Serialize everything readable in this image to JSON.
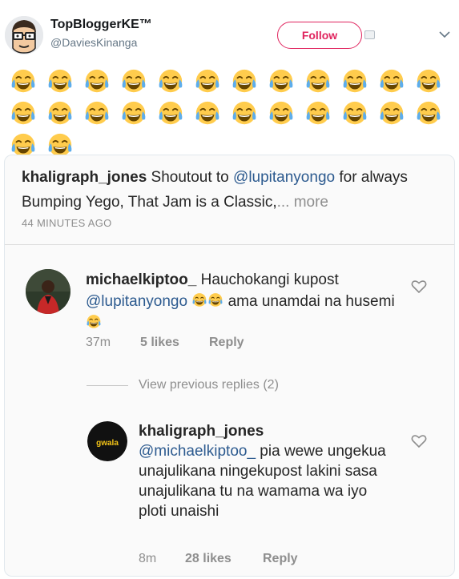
{
  "tweet": {
    "author_name": "TopBloggerKE™",
    "author_handle": "@DaviesKinanga",
    "follow_label": "Follow",
    "emoji_count": 26,
    "emoji_name": "face-with-tears-of-joy"
  },
  "instagram": {
    "caption": {
      "user": "khaligraph_jones",
      "text_before": " Shoutout to ",
      "mention": "@lupitanyongo",
      "text_after": " for always Bumping Yego, That Jam is a Classic,",
      "more": "... more"
    },
    "timestamp": "44 MINUTES AGO",
    "comments": [
      {
        "user": "michaelkiptoo_",
        "text_1": " Hauchokangi kupost ",
        "mention": "@lupitanyongo",
        "text_2": " ama unamdai na husemi",
        "time": "37m",
        "likes": "5 likes",
        "reply": "Reply"
      },
      {
        "user": "khaligraph_jones",
        "mention": "@michaelkiptoo_",
        "text": " pia wewe ungekua unajulikana ningekupost lakini sasa unajulikana tu na wamama wa iyo ploti unaishi",
        "time": "8m",
        "likes": "28 likes",
        "reply": "Reply",
        "avatar_text": "gwala"
      }
    ],
    "view_replies": "View previous replies (2)"
  },
  "colors": {
    "follow": "#e0245e",
    "mention": "#2c5a8f",
    "muted": "#8e8e8e"
  }
}
